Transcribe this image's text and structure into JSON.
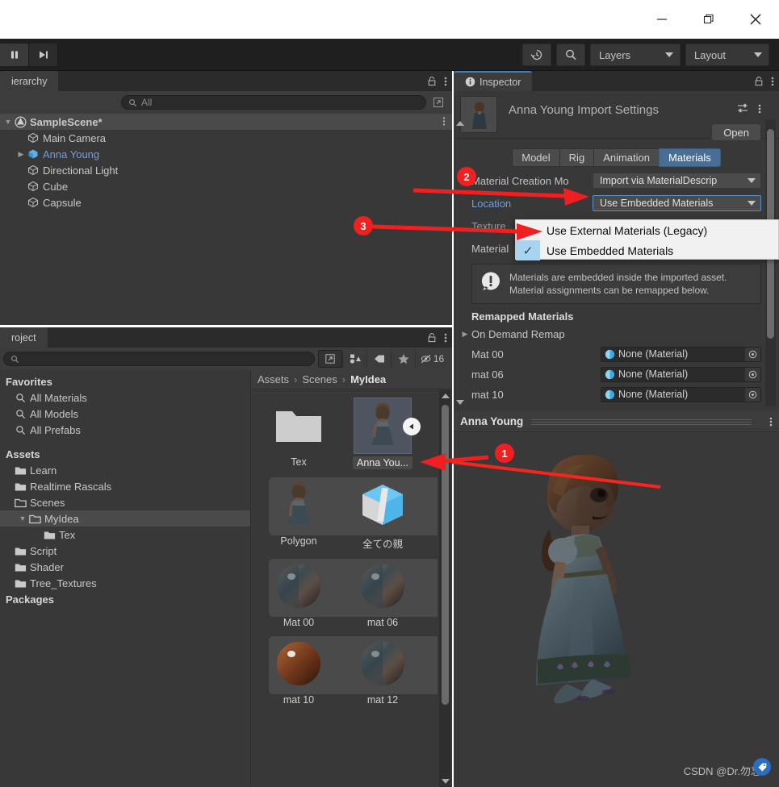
{
  "window": {
    "buttons": [
      {
        "name": "minimize",
        "glyph": "minimize-icon"
      },
      {
        "name": "maximize",
        "glyph": "maximize-icon"
      },
      {
        "name": "close",
        "glyph": "close-icon"
      }
    ]
  },
  "toolbar": {
    "pause_label": "pause-icon",
    "step_label": "step-icon",
    "history_icon": "history-icon",
    "search_icon": "search-icon",
    "layers_label": "Layers",
    "layout_label": "Layout"
  },
  "hierarchy": {
    "tab_label": "ierarchy",
    "search_placeholder": "All",
    "search_value": "",
    "rows": [
      {
        "label": "SampleScene*",
        "depth": 0,
        "icon": "unity-scene-icon",
        "expanded": true,
        "selected": false,
        "blue": false
      },
      {
        "label": "Main Camera",
        "depth": 1,
        "icon": "gameobject-icon",
        "expanded": null,
        "selected": false,
        "blue": false
      },
      {
        "label": "Anna Young",
        "depth": 1,
        "icon": "prefab-icon",
        "expanded": false,
        "selected": false,
        "blue": true
      },
      {
        "label": "Directional Light",
        "depth": 1,
        "icon": "gameobject-icon",
        "expanded": null,
        "selected": false,
        "blue": false
      },
      {
        "label": "Cube",
        "depth": 1,
        "icon": "gameobject-icon",
        "expanded": null,
        "selected": false,
        "blue": false
      },
      {
        "label": "Capsule",
        "depth": 1,
        "icon": "gameobject-icon",
        "expanded": null,
        "selected": false,
        "blue": false
      }
    ]
  },
  "project": {
    "tab_label": "roject",
    "search_placeholder": "",
    "search_value": "",
    "toolbar_icons": [
      "open-in-new-icon",
      "asset-filter-icon",
      "label-tag-icon",
      "favorite-star-icon",
      "hidden-eye-icon"
    ],
    "hidden_count": "16",
    "tree": [
      {
        "label": "Favorites",
        "type": "header",
        "depth": 0
      },
      {
        "label": "All Materials",
        "type": "search",
        "depth": 1
      },
      {
        "label": "All Models",
        "type": "search",
        "depth": 1
      },
      {
        "label": "All Prefabs",
        "type": "search",
        "depth": 1
      },
      {
        "label": "",
        "type": "spacer",
        "depth": 0
      },
      {
        "label": "Assets",
        "type": "header",
        "depth": 0
      },
      {
        "label": "Learn",
        "type": "folder",
        "depth": 1
      },
      {
        "label": "Realtime Rascals",
        "type": "folder",
        "depth": 1
      },
      {
        "label": "Scenes",
        "type": "folder-open",
        "depth": 1
      },
      {
        "label": "MyIdea",
        "type": "folder-open",
        "depth": 2,
        "selected": true,
        "expanded": true
      },
      {
        "label": "Tex",
        "type": "folder",
        "depth": 3
      },
      {
        "label": "Script",
        "type": "folder",
        "depth": 1
      },
      {
        "label": "Shader",
        "type": "folder",
        "depth": 1
      },
      {
        "label": "Tree_Textures",
        "type": "folder",
        "depth": 1
      },
      {
        "label": "Packages",
        "type": "header",
        "depth": 0
      }
    ],
    "breadcrumb": [
      "Assets",
      "Scenes",
      "MyIdea"
    ],
    "grid": [
      [
        {
          "label": "Tex",
          "kind": "folder",
          "selected": false
        },
        {
          "label": "Anna You...",
          "kind": "model-preview",
          "selected": true
        }
      ],
      [
        {
          "label": "Polygon",
          "kind": "model-preview",
          "selected": false
        },
        {
          "label": "全ての親",
          "kind": "prefab",
          "selected": false
        }
      ],
      [
        {
          "label": "Mat 00",
          "kind": "material",
          "swatch": "steel",
          "selected": false
        },
        {
          "label": "mat 06",
          "kind": "material",
          "swatch": "steel",
          "selected": false
        }
      ],
      [
        {
          "label": "mat 10",
          "kind": "material",
          "swatch": "brown",
          "selected": false
        },
        {
          "label": "mat 12",
          "kind": "material",
          "swatch": "steel",
          "selected": false
        }
      ]
    ]
  },
  "inspector": {
    "tab_label": "Inspector",
    "title": "Anna Young Import Settings",
    "open_label": "Open",
    "tabs": [
      {
        "label": "Model",
        "active": false
      },
      {
        "label": "Rig",
        "active": false
      },
      {
        "label": "Animation",
        "active": false
      },
      {
        "label": "Materials",
        "active": true
      }
    ],
    "properties": [
      {
        "label": "Material Creation Mo",
        "value": "Import via MaterialDescrip",
        "blue": false,
        "focus": false
      },
      {
        "label": "Location",
        "value": "Use Embedded Materials",
        "blue": true,
        "focus": true
      },
      {
        "label": "Texture",
        "value": "",
        "blue": false,
        "focus": false
      },
      {
        "label": "Material",
        "value": "",
        "blue": false,
        "focus": false
      }
    ],
    "helpbox": "Materials are embedded inside the imported asset. Material assignments can be remapped below.",
    "remapped_header": "Remapped Materials",
    "on_demand_remap": "On Demand Remap",
    "remapped": [
      {
        "name": "Mat 00",
        "value": "None (Material)"
      },
      {
        "name": "mat 06",
        "value": "None (Material)"
      },
      {
        "name": "mat 10",
        "value": "None (Material)"
      }
    ]
  },
  "dropdown": {
    "items": [
      {
        "label": "Use External Materials (Legacy)",
        "checked": false
      },
      {
        "label": "Use Embedded Materials",
        "checked": true
      }
    ]
  },
  "preview": {
    "title": "Anna Young",
    "watermark": "CSDN @Dr.勿忘"
  },
  "annotations": [
    {
      "id": "1",
      "label": "1"
    },
    {
      "id": "2",
      "label": "2"
    },
    {
      "id": "3",
      "label": "3"
    }
  ],
  "colors": {
    "accent_blue": "#4a6d93",
    "panel_bg": "#383838",
    "tab_bg": "#3c3c3c",
    "annotation_red": "#f02020",
    "link_blue": "#6f9fe0"
  }
}
